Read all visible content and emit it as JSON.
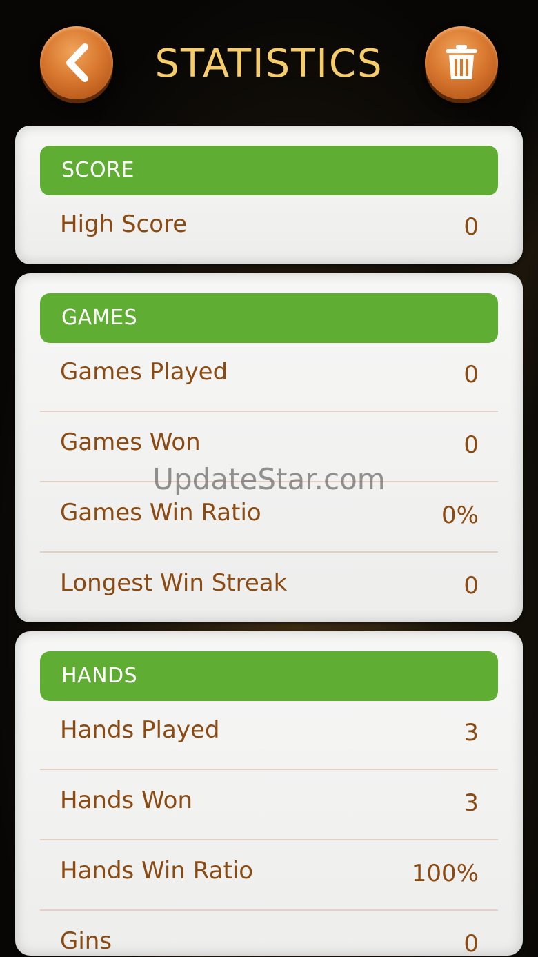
{
  "header": {
    "title": "STATISTICS"
  },
  "score": {
    "heading": "SCORE",
    "rows": [
      {
        "label": "High Score",
        "value": "0"
      }
    ]
  },
  "games": {
    "heading": "GAMES",
    "rows": [
      {
        "label": "Games Played",
        "value": "0"
      },
      {
        "label": "Games Won",
        "value": "0"
      },
      {
        "label": "Games Win Ratio",
        "value": "0%"
      },
      {
        "label": "Longest Win Streak",
        "value": "0"
      }
    ]
  },
  "hands": {
    "heading": "HANDS",
    "rows": [
      {
        "label": "Hands Played",
        "value": "3"
      },
      {
        "label": "Hands Won",
        "value": "3"
      },
      {
        "label": "Hands Win Ratio",
        "value": "100%"
      },
      {
        "label": "Gins",
        "value": "0"
      }
    ]
  },
  "watermark": "UpdateStar.com",
  "colors": {
    "accent_orange": "#d9782f",
    "title_gold": "#f6cd6a",
    "section_green": "#5fae33",
    "text_brown": "#8b4a12",
    "card_bg": "#f3f3f2"
  },
  "icons": {
    "back": "chevron-left-icon",
    "delete": "trash-icon"
  }
}
